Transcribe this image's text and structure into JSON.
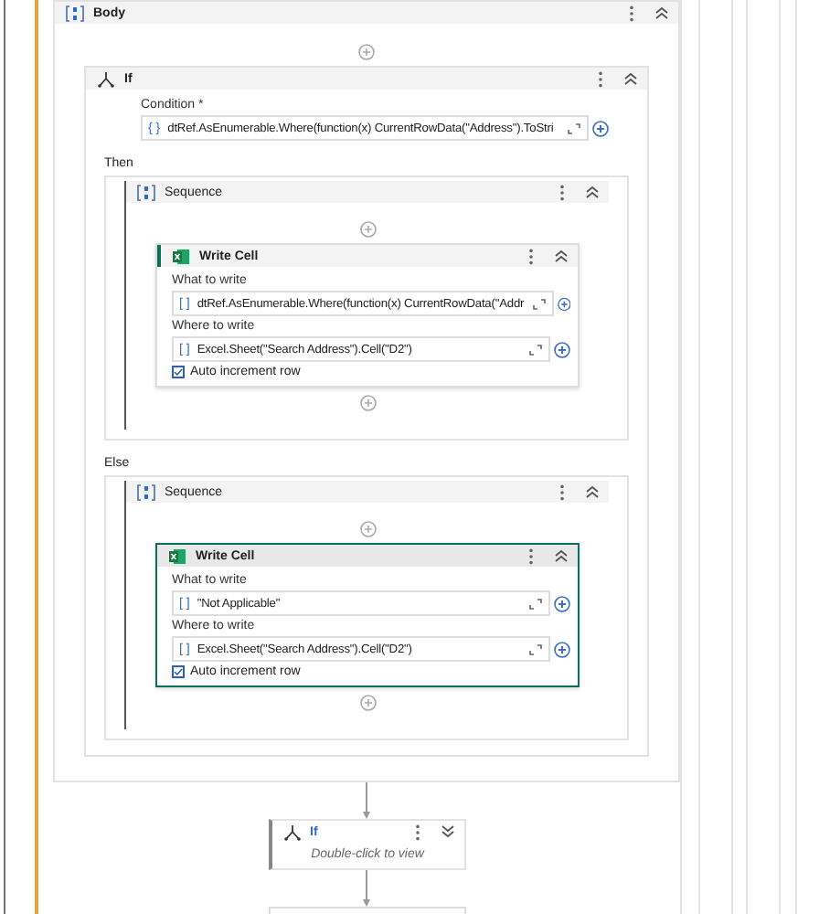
{
  "body": {
    "title": "Body",
    "expanded": true,
    "if": {
      "title": "If",
      "expanded": true,
      "condition": {
        "label": "Condition *",
        "type": "{ }",
        "value": "dtRef.AsEnumerable.Where(function(x) CurrentRowData(\"Address\").ToStri"
      },
      "branches": [
        {
          "label": "Then",
          "sequence": {
            "title": "Sequence",
            "expanded": true,
            "activity": {
              "title": "Write Cell",
              "selected": false,
              "expanded": true,
              "fields": [
                {
                  "label": "What to write",
                  "type": "[ ]",
                  "value": "dtRef.AsEnumerable.Where(function(x) CurrentRowData(\"Addr"
                },
                {
                  "label": "Where to write",
                  "type": "[ ]",
                  "value": "Excel.Sheet(\"Search Address\").Cell(\"D2\")"
                }
              ],
              "checkbox": {
                "label": "Auto increment row",
                "checked": true
              }
            }
          }
        },
        {
          "label": "Else",
          "sequence": {
            "title": "Sequence",
            "expanded": true,
            "activity": {
              "title": "Write Cell",
              "selected": true,
              "expanded": true,
              "fields": [
                {
                  "label": "What to write",
                  "type": "[ ]",
                  "value": "\"Not Applicable\""
                },
                {
                  "label": "Where to write",
                  "type": "[ ]",
                  "value": "Excel.Sheet(\"Search Address\").Cell(\"D2\")"
                }
              ],
              "checkbox": {
                "label": "Auto increment row",
                "checked": true
              }
            }
          }
        }
      ]
    }
  },
  "next_activity": {
    "title": "If",
    "expanded": false,
    "hint": "Double-click to view"
  }
}
